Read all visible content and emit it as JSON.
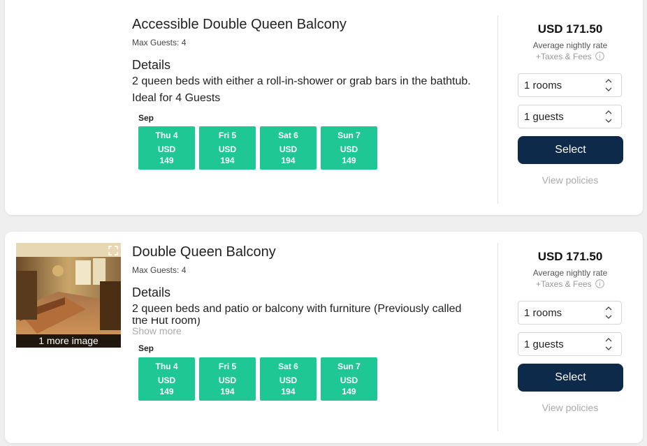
{
  "rooms": [
    {
      "title": "Accessible Double Queen Balcony",
      "max_guests": "Max Guests: 4",
      "details_heading": "Details",
      "details_line1": "2 queen beds with either a roll-in-shower or grab bars in the bathtub.",
      "details_line2": "Ideal for 4 Guests",
      "month": "Sep",
      "dates": [
        {
          "day": "Thu 4",
          "currency": "USD",
          "price": "149"
        },
        {
          "day": "Fri 5",
          "currency": "USD",
          "price": "194"
        },
        {
          "day": "Sat 6",
          "currency": "USD",
          "price": "194"
        },
        {
          "day": "Sun 7",
          "currency": "USD",
          "price": "149"
        }
      ],
      "price": "USD 171.50",
      "nightly_label": "Average nightly rate",
      "taxes_label": "+Taxes & Fees",
      "rooms_select": "1 rooms",
      "guests_select": "1 guests",
      "select_label": "Select",
      "policies_label": "View policies"
    },
    {
      "title": "Double Queen Balcony",
      "max_guests": "Max Guests: 4",
      "details_heading": "Details",
      "details_line1": "2 queen beds and patio or balcony with furniture (Previously called",
      "details_line2": "the Hut room)",
      "show_more": "Show more",
      "photo_caption": "1 more image",
      "month": "Sep",
      "dates": [
        {
          "day": "Thu 4",
          "currency": "USD",
          "price": "149"
        },
        {
          "day": "Fri 5",
          "currency": "USD",
          "price": "194"
        },
        {
          "day": "Sat 6",
          "currency": "USD",
          "price": "194"
        },
        {
          "day": "Sun 7",
          "currency": "USD",
          "price": "149"
        }
      ],
      "price": "USD 171.50",
      "nightly_label": "Average nightly rate",
      "taxes_label": "+Taxes & Fees",
      "rooms_select": "1 rooms",
      "guests_select": "1 guests",
      "select_label": "Select",
      "policies_label": "View policies"
    }
  ],
  "icons": {
    "info": "info-circle-icon",
    "stepper": "chevron-up-down-icon",
    "expand": "expand-icon"
  },
  "colors": {
    "date_green": "#1fc794",
    "select_navy": "#0e2a4b",
    "muted_gray": "#aaaaaa"
  }
}
